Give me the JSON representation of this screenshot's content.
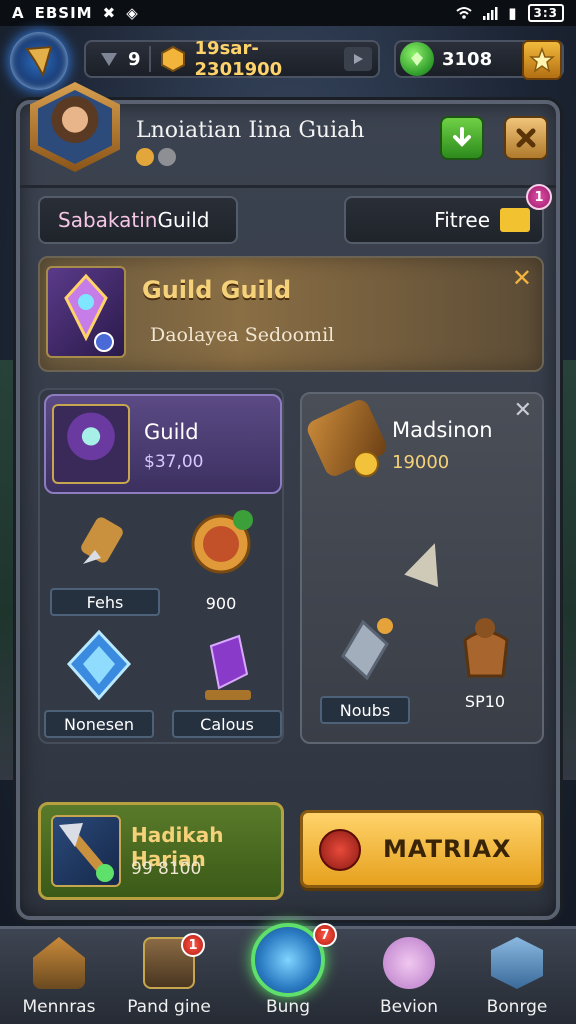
{
  "status_bar": {
    "left_text": "EBSIM",
    "battery_text": "3:3"
  },
  "resources": {
    "level": "9",
    "gold": "19sar-2301900",
    "gems": "3108"
  },
  "header": {
    "title": "Lnoiatian Iina Guiah"
  },
  "selectors": {
    "guild_prefix": "Sabakatin",
    "guild_suffix": " Guild",
    "filter_label": "Fitree",
    "filter_badge": "1"
  },
  "banner": {
    "title": "Guild Guild",
    "subtitle": "Daolayea Sedoomil"
  },
  "guild_card": {
    "name": "Guild",
    "value": "$37,00"
  },
  "items": [
    {
      "label": "Fehs"
    },
    {
      "label": "900"
    },
    {
      "label": "Nonesen"
    },
    {
      "label": "Calous"
    }
  ],
  "right_card": {
    "title": "Madsinon",
    "value": "19000",
    "items": [
      {
        "label": "Noubs"
      },
      {
        "label": "SP10"
      }
    ]
  },
  "reward": {
    "label": "Hadikah Harian",
    "value": "99 8100"
  },
  "max_button": {
    "label": "MATRIAX"
  },
  "bottom_nav": [
    {
      "label": "Mennras",
      "badge": ""
    },
    {
      "label": "Pand gine",
      "badge": "1"
    },
    {
      "label": "Bung",
      "badge": "7"
    },
    {
      "label": "Bevion",
      "badge": ""
    },
    {
      "label": "Bonrge",
      "badge": ""
    }
  ],
  "colors": {
    "accent_gold": "#f5d27a",
    "accent_green": "#5fe06a",
    "panel": "#3c4350"
  }
}
